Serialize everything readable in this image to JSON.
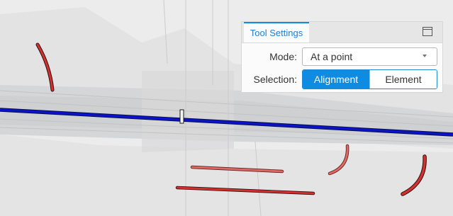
{
  "tool_settings": {
    "tab_label": "Tool Settings",
    "dock_icon": "window-icon",
    "mode": {
      "label": "Mode:",
      "selected": "At a point"
    },
    "selection": {
      "label": "Selection:",
      "options": [
        "Alignment",
        "Element"
      ],
      "active": "Alignment"
    }
  },
  "colors": {
    "alignment_line": "#0b12c8",
    "element_red": "#d4302f",
    "element_pink": "#e06a63",
    "accent": "#108be2"
  }
}
